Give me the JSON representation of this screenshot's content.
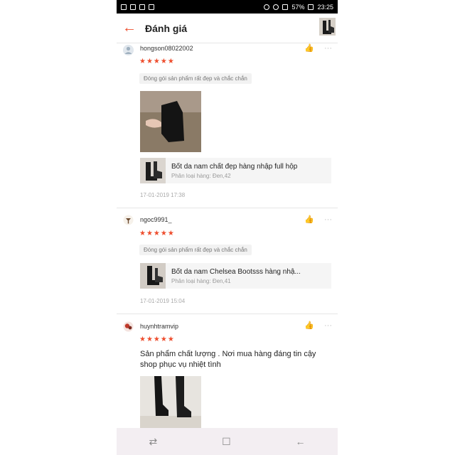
{
  "status_bar": {
    "battery": "57%",
    "time": "23:25"
  },
  "header": {
    "title": "Đánh giá",
    "back_icon": "arrow-left-icon"
  },
  "colors": {
    "accent": "#ee4d2d"
  },
  "reviews": [
    {
      "username": "hongson08022002",
      "rating": 5,
      "stars": "★★★★★",
      "tag": "Đóng gói sản phẩm rất đẹp và chắc chắn",
      "product_name": "Bốt da nam chất đẹp hàng nhập full hộp",
      "product_variant": "Phân loại hàng: Đen,42",
      "timestamp": "17-01-2019 17:38"
    },
    {
      "username": "ngoc9991_",
      "rating": 5,
      "stars": "★★★★★",
      "tag": "Đóng gói sản phẩm rất đẹp và chắc chắn",
      "product_name": "Bốt da nam Chelsea Bootsss hàng nhậ...",
      "product_variant": "Phân loại hàng: Đen,41",
      "timestamp": "17-01-2019 15:04"
    },
    {
      "username": "huynhtramvip",
      "rating": 5,
      "stars": "★★★★★",
      "text": "Sản phẩm chất lượng . Nơi mua hàng đáng tin cậy shop phục vụ nhiệt tình"
    }
  ],
  "nav": {
    "recent": "⇄",
    "home": "☐",
    "back": "←"
  }
}
